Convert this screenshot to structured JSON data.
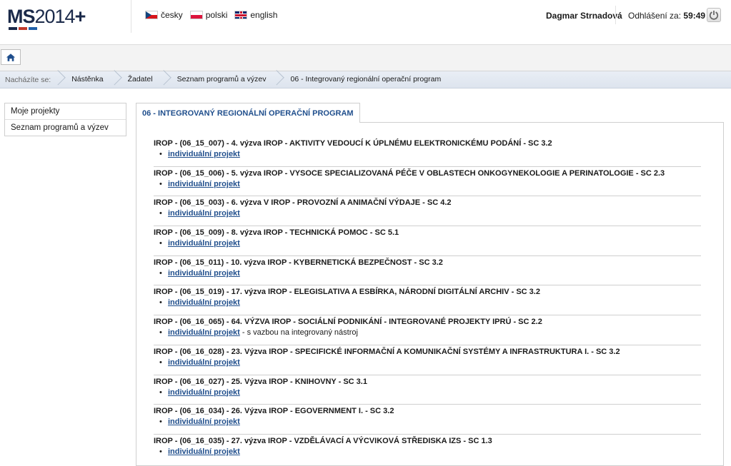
{
  "header": {
    "logo": {
      "ms": "MS",
      "year": "2014",
      "plus": "+"
    },
    "logo_colors": [
      "#1b2a4a",
      "#c0392b",
      "#1f5fa8"
    ],
    "languages": [
      {
        "label": "česky",
        "flag": "cz-flag-icon"
      },
      {
        "label": "polski",
        "flag": "pl-flag-icon"
      },
      {
        "label": "english",
        "flag": "gb-flag-icon"
      }
    ],
    "user_name": "Dagmar Strnadová",
    "logout_label": "Odhlášení za:",
    "logout_time": "59:49",
    "power_icon": "power-icon"
  },
  "toolbar": {
    "home_icon": "home-icon"
  },
  "breadcrumb": {
    "label": "Nacházíte se:",
    "items": [
      "Nástěnka",
      "Žadatel",
      "Seznam programů a výzev",
      "06 - Integrovaný regionální operační program"
    ]
  },
  "sidebar": {
    "items": [
      "Moje projekty",
      "Seznam programů a výzev"
    ]
  },
  "main": {
    "tab_title": "06 - INTEGROVANÝ REGIONÁLNÍ OPERAČNÍ PROGRAM",
    "link_color": "#1f4e8c",
    "entries": [
      {
        "title": "IROP - (06_15_007) - 4. výzva IROP - AKTIVITY VEDOUCÍ K ÚPLNÉMU ELEKTRONICKÉMU PODÁNÍ - SC 3.2",
        "link": "individuální projekt",
        "suffix": ""
      },
      {
        "title": "IROP - (06_15_006) - 5. výzva IROP - VYSOCE SPECIALIZOVANÁ PÉČE V OBLASTECH ONKOGYNEKOLOGIE A PERINATOLOGIE - SC 2.3",
        "link": "individuální projekt",
        "suffix": ""
      },
      {
        "title": "IROP - (06_15_003) - 6. výzva V IROP - PROVOZNÍ A ANIMAČNÍ VÝDAJE - SC 4.2",
        "link": "individuální projekt",
        "suffix": ""
      },
      {
        "title": "IROP - (06_15_009) - 8. výzva IROP - TECHNICKÁ POMOC - SC 5.1",
        "link": "individuální projekt",
        "suffix": ""
      },
      {
        "title": "IROP - (06_15_011) - 10. výzva IROP - KYBERNETICKÁ BEZPEČNOST - SC 3.2",
        "link": "individuální projekt",
        "suffix": ""
      },
      {
        "title": "IROP - (06_15_019) - 17. výzva IROP - ELEGISLATIVA A ESBÍRKA, NÁRODNÍ DIGITÁLNÍ ARCHIV - SC 3.2",
        "link": "individuální projekt",
        "suffix": ""
      },
      {
        "title": "IROP - (06_16_065) - 64. VÝZVA IROP - SOCIÁLNÍ PODNIKÁNÍ - INTEGROVANÉ PROJEKTY IPRÚ - SC 2.2",
        "link": "individuální projekt",
        "suffix": " - s vazbou na integrovaný nástroj"
      },
      {
        "title": "IROP - (06_16_028) - 23. Výzva IROP - SPECIFICKÉ INFORMAČNÍ A KOMUNIKAČNÍ SYSTÉMY A INFRASTRUKTURA I. - SC 3.2",
        "link": "individuální projekt",
        "suffix": ""
      },
      {
        "title": "IROP - (06_16_027) - 25. Výzva IROP - KNIHOVNY - SC 3.1",
        "link": "individuální projekt",
        "suffix": ""
      },
      {
        "title": "IROP - (06_16_034) - 26. Výzva IROP - EGOVERNMENT I. - SC 3.2",
        "link": "individuální projekt",
        "suffix": ""
      },
      {
        "title": "IROP - (06_16_035) - 27. výzva IROP - VZDĚLÁVACÍ A VÝCVIKOVÁ STŘEDISKA IZS - SC 1.3",
        "link": "individuální projekt",
        "suffix": ""
      }
    ]
  }
}
